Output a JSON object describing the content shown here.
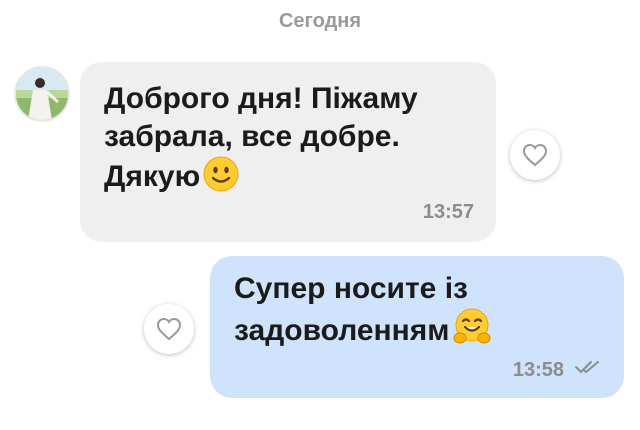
{
  "chat": {
    "date_separator": "Сегодня",
    "messages": [
      {
        "direction": "incoming",
        "text": "Доброго дня! Піжаму забрала, все добре. Дякую",
        "emoji": "slightly-smiling-face-emoji",
        "time": "13:57",
        "bubble_color": "#efefef"
      },
      {
        "direction": "outgoing",
        "text": "Супер носите із задоволенням",
        "emoji": "hugging-face-emoji",
        "time": "13:58",
        "status": "double-check-read-icon",
        "bubble_color": "#cfe3fc"
      }
    ]
  },
  "icons": {
    "like": "heart-outline-icon",
    "avatar": "contact-avatar"
  }
}
